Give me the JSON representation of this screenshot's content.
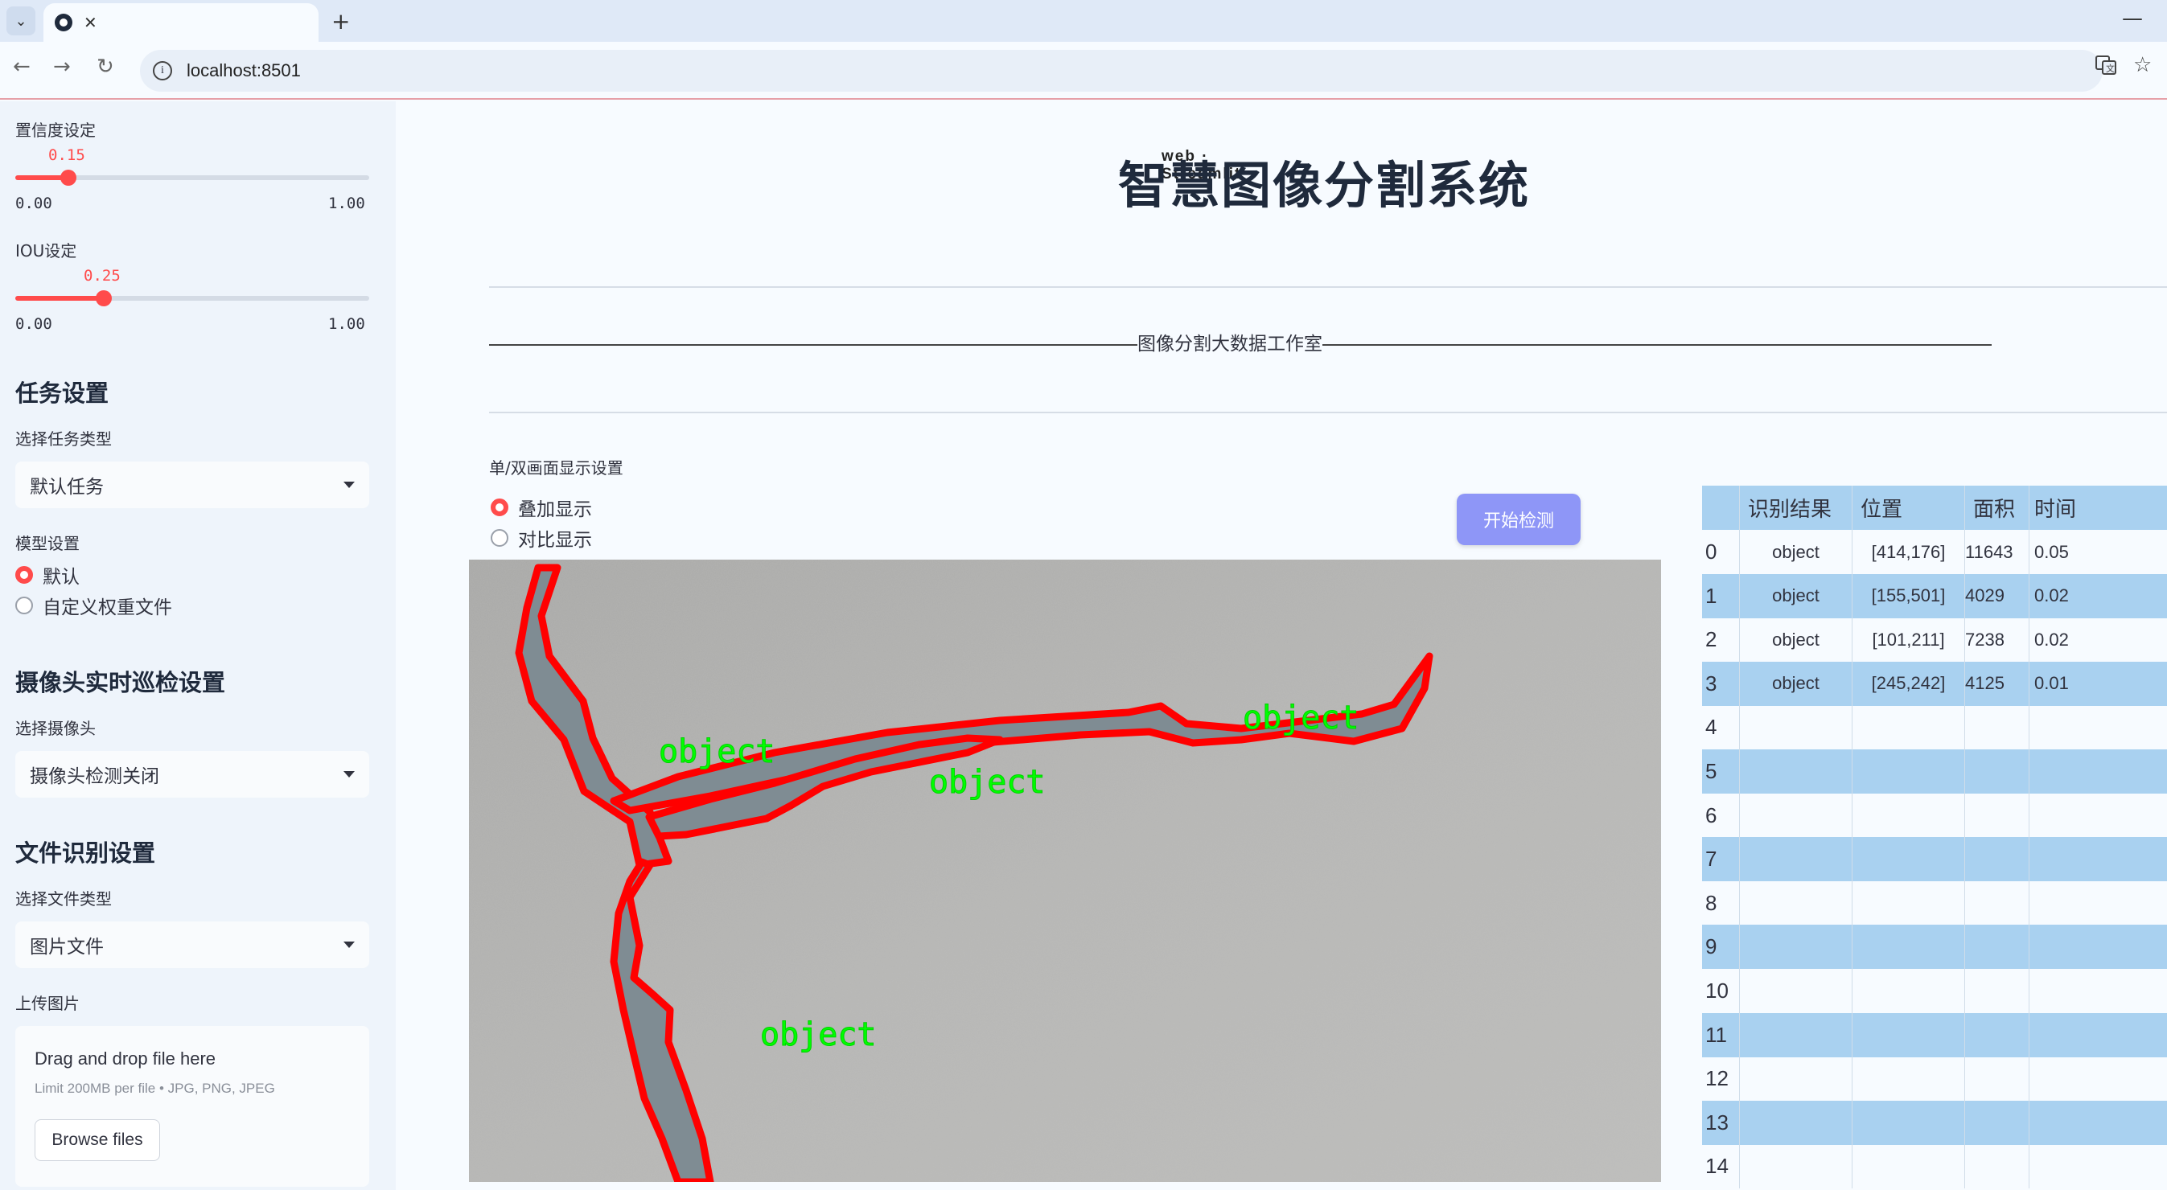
{
  "browser": {
    "tab_title": "web · Streamlit",
    "url": "localhost:8501"
  },
  "sidebar": {
    "confidence": {
      "label": "置信度设定",
      "value": "0.15",
      "min": "0.00",
      "max": "1.00",
      "fraction": 0.15
    },
    "iou": {
      "label": "IOU设定",
      "value": "0.25",
      "min": "0.00",
      "max": "1.00",
      "fraction": 0.25
    },
    "task_section": "任务设置",
    "task_type_label": "选择任务类型",
    "task_type_value": "默认任务",
    "model_label": "模型设置",
    "model_options": [
      "默认",
      "自定义权重文件"
    ],
    "camera_section": "摄像头实时巡检设置",
    "camera_label": "选择摄像头",
    "camera_value": "摄像头检测关闭",
    "file_section": "文件识别设置",
    "file_type_label": "选择文件类型",
    "file_type_value": "图片文件",
    "upload_label": "上传图片",
    "upload_title": "Drag and drop file here",
    "upload_limit": "Limit 200MB per file • JPG, PNG, JPEG",
    "browse_label": "Browse files"
  },
  "main": {
    "title": "智慧图像分割系统",
    "subtitle": "图像分割大数据工作室",
    "display_label": "单/双画面显示设置",
    "display_options": [
      "叠加显示",
      "对比显示"
    ],
    "start_button": "开始检测",
    "detection_labels": [
      "object",
      "object",
      "object",
      "object"
    ]
  },
  "table": {
    "headers": [
      "识别结果",
      "位置",
      "面积",
      "时间"
    ],
    "rows": [
      {
        "idx": "0",
        "result": "object",
        "pos": "[414,176]",
        "area": "11643",
        "time": "0.05"
      },
      {
        "idx": "1",
        "result": "object",
        "pos": "[155,501]",
        "area": "4029",
        "time": "0.02"
      },
      {
        "idx": "2",
        "result": "object",
        "pos": "[101,211]",
        "area": "7238",
        "time": "0.02"
      },
      {
        "idx": "3",
        "result": "object",
        "pos": "[245,242]",
        "area": "4125",
        "time": "0.01"
      },
      {
        "idx": "4",
        "result": "",
        "pos": "",
        "area": "",
        "time": ""
      },
      {
        "idx": "5",
        "result": "",
        "pos": "",
        "area": "",
        "time": ""
      },
      {
        "idx": "6",
        "result": "",
        "pos": "",
        "area": "",
        "time": ""
      },
      {
        "idx": "7",
        "result": "",
        "pos": "",
        "area": "",
        "time": ""
      },
      {
        "idx": "8",
        "result": "",
        "pos": "",
        "area": "",
        "time": ""
      },
      {
        "idx": "9",
        "result": "",
        "pos": "",
        "area": "",
        "time": ""
      },
      {
        "idx": "10",
        "result": "",
        "pos": "",
        "area": "",
        "time": ""
      },
      {
        "idx": "11",
        "result": "",
        "pos": "",
        "area": "",
        "time": ""
      },
      {
        "idx": "12",
        "result": "",
        "pos": "",
        "area": "",
        "time": ""
      },
      {
        "idx": "13",
        "result": "",
        "pos": "",
        "area": "",
        "time": ""
      },
      {
        "idx": "14",
        "result": "",
        "pos": "",
        "area": "",
        "time": ""
      }
    ]
  },
  "colors": {
    "accent": "#ff4b4b",
    "button": "#8e96f7",
    "table_header": "#a9d1f0",
    "table_stripe": "#a9d1f0",
    "mask_outline": "#ff0000",
    "label_text": "#00ff00"
  }
}
